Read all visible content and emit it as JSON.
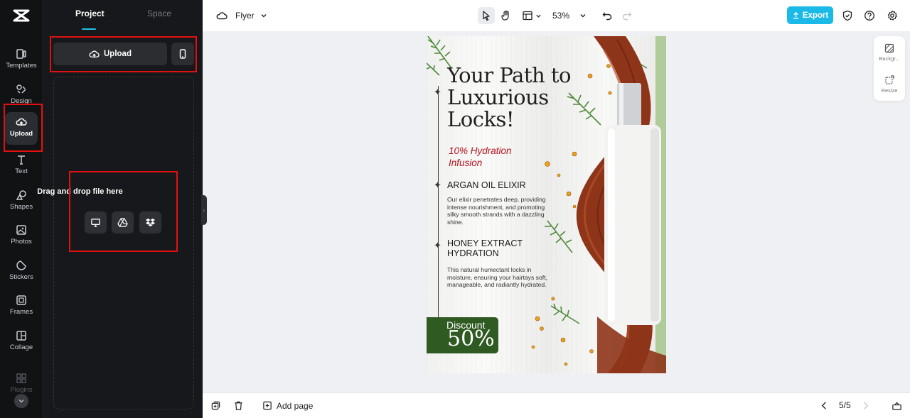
{
  "app": {
    "logo_icon": "capcut-logo-icon"
  },
  "rail": {
    "items": [
      {
        "label": "Templates",
        "icon": "templates-icon"
      },
      {
        "label": "Design",
        "icon": "design-icon"
      },
      {
        "label": "Upload",
        "icon": "upload-cloud-icon"
      },
      {
        "label": "Text",
        "icon": "text-icon"
      },
      {
        "label": "Shapes",
        "icon": "shapes-icon"
      },
      {
        "label": "Photos",
        "icon": "photos-icon"
      },
      {
        "label": "Stickers",
        "icon": "stickers-icon"
      },
      {
        "label": "Frames",
        "icon": "frames-icon"
      },
      {
        "label": "Collage",
        "icon": "collage-icon"
      },
      {
        "label": "Plugins",
        "icon": "plugins-icon"
      }
    ]
  },
  "panel": {
    "tabs": [
      {
        "label": "Project"
      },
      {
        "label": "Space"
      }
    ],
    "upload_label": "Upload",
    "drop_text": "Drag and drop file here"
  },
  "topbar": {
    "doc_name": "Flyer",
    "zoom": "53%",
    "export_label": "Export"
  },
  "side_tools": {
    "background_label": "Backgr...",
    "resize_label": "Resize"
  },
  "bottombar": {
    "add_page_label": "Add page",
    "page_indicator": "5/5"
  },
  "flyer": {
    "title": "Your Path to Luxurious Locks!",
    "subtitle": "10% Hydration Infusion",
    "heading1": "ARGAN OIL ELIXIR",
    "para1": "Our elixir penetrates deep, providing intense nourishment, and promoting silky smooth strands with a dazzling shine.",
    "heading2": "HONEY EXTRACT HYDRATION",
    "para2": "This natural humectant locks in moisture, ensuring your hairtays soft, manageable, and radiantly hydrated.",
    "discount_label": "Discount",
    "discount_value": "50%"
  },
  "colors": {
    "accent": "#1ab9e8",
    "highlight_box": "#e01010",
    "flyer_red": "#b3141d",
    "flyer_green": "#2f5a21"
  }
}
